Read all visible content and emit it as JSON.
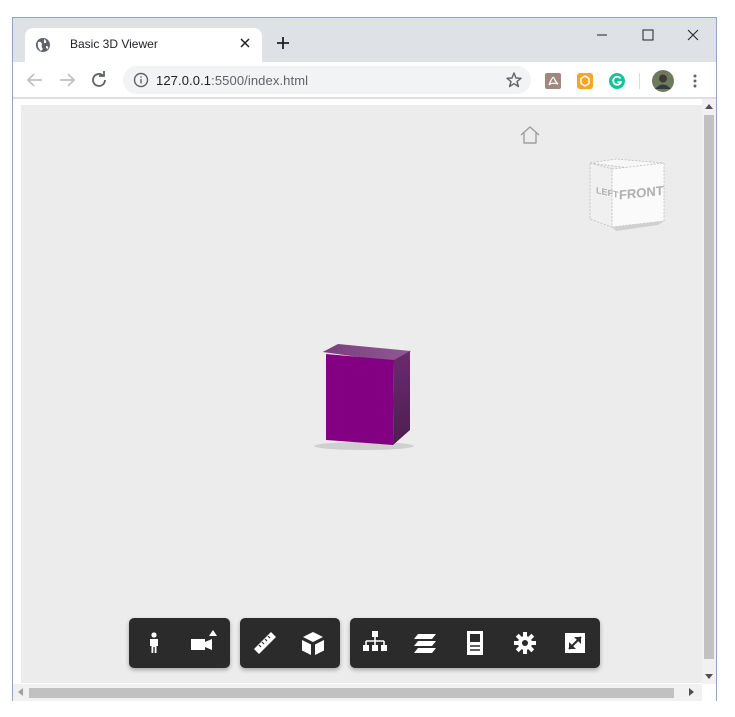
{
  "browser": {
    "tab_title": "Basic 3D Viewer",
    "url_host": "127.0.0.1",
    "url_rest": ":5500/index.html"
  },
  "viewer": {
    "viewcube_left_label": "LEFT",
    "viewcube_front_label": "FRONT",
    "model_color": "#800080",
    "toolbar_groups": [
      [
        "first-person",
        "camera"
      ],
      [
        "measure",
        "section"
      ],
      [
        "model-browser",
        "layers",
        "properties",
        "settings",
        "fullscreen"
      ]
    ]
  }
}
